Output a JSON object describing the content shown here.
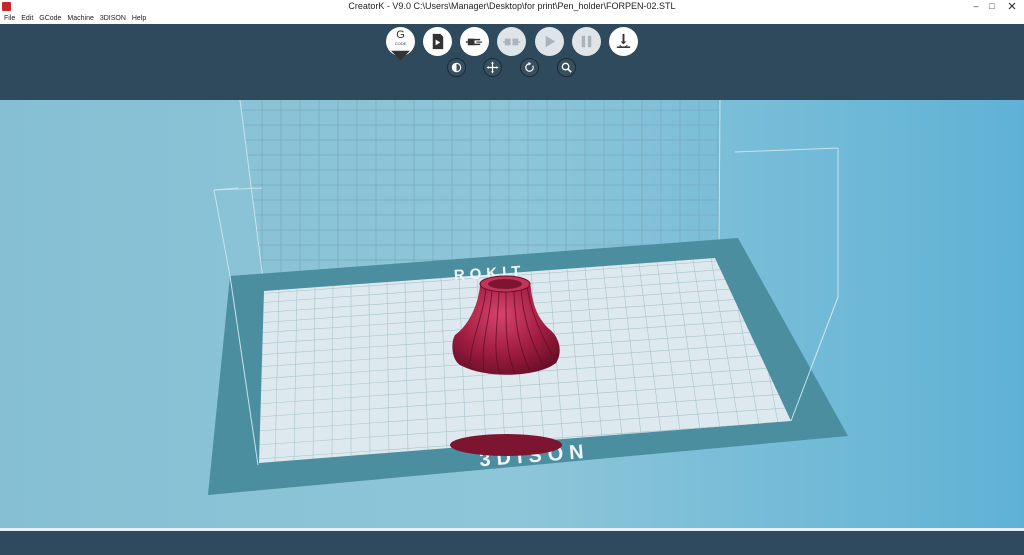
{
  "window": {
    "title": "CreatorK - V9.0  C:\\Users\\Manager\\Desktop\\for print\\Pen_holder\\FORPEN-02.STL",
    "minimize": "–",
    "maximize": "□"
  },
  "menu": [
    "File",
    "Edit",
    "GCode",
    "Machine",
    "3DISON",
    "Help"
  ],
  "toolbar": {
    "buttons": [
      {
        "name": "generate-gcode-button",
        "icon": "gcode-icon",
        "label": "G",
        "sublabel": "CODE",
        "enabled": true
      },
      {
        "name": "save-to-sd-button",
        "icon": "sd-card-icon",
        "enabled": true
      },
      {
        "name": "connect-button",
        "icon": "plug-icon",
        "enabled": true
      },
      {
        "name": "disconnect-button",
        "icon": "unplug-icon",
        "enabled": false
      },
      {
        "name": "play-button",
        "icon": "play-icon",
        "enabled": false
      },
      {
        "name": "pause-button",
        "icon": "pause-icon",
        "enabled": false
      },
      {
        "name": "level-bed-button",
        "icon": "nozzle-icon",
        "enabled": true
      }
    ],
    "view_buttons": [
      {
        "name": "view-toggle-button",
        "icon": "half-circle-icon"
      },
      {
        "name": "move-button",
        "icon": "move-arrows-icon"
      },
      {
        "name": "rotate-button",
        "icon": "rotate-icon"
      },
      {
        "name": "zoom-button",
        "icon": "magnifier-icon"
      }
    ]
  },
  "viewport": {
    "bed_label_back": "ROKIT",
    "bed_label_front": "3DISON",
    "model_color": "#9e1b3c",
    "background_color": "#8ec6d9",
    "bed_border_color": "#4a8ea0",
    "bed_surface_color": "#dde9ee"
  }
}
